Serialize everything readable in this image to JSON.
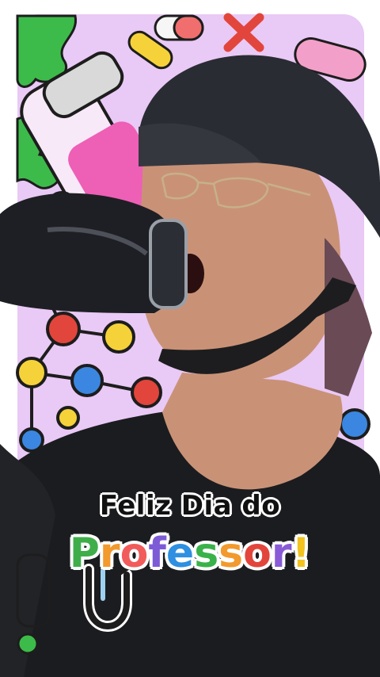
{
  "caption": {
    "line1": "Feliz Dia do",
    "line2": "Professor!",
    "line2_colors": [
      "#3fae4a",
      "#f29a2e",
      "#f25b5b",
      "#7d5bd6",
      "#2f8fe0",
      "#39b24a",
      "#f29a2e",
      "#e2453c",
      "#8a5bd6",
      "#f2c21f"
    ]
  },
  "scene": {
    "description_colors": {
      "background_lilac": "#e9c9f5",
      "cap": "#2a2c33",
      "shirt": "#1b1c1f",
      "skin": "#c99277",
      "bottle": "#1e1f24"
    },
    "icons": [
      "test-tube-icon",
      "molecule-icon",
      "pill-icon",
      "x-mark-icon",
      "slime-splat-icon",
      "paperclip-icon"
    ]
  }
}
